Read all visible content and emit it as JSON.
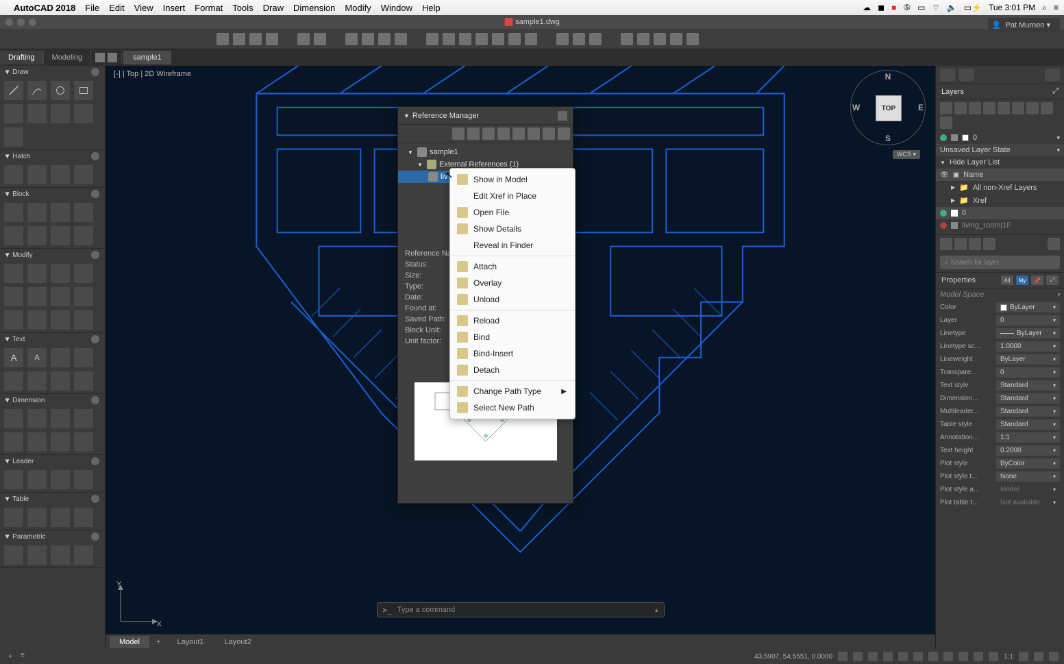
{
  "menubar": {
    "app_name": "AutoCAD 2018",
    "items": [
      "File",
      "Edit",
      "View",
      "Insert",
      "Format",
      "Tools",
      "Draw",
      "Dimension",
      "Modify",
      "Window",
      "Help"
    ],
    "clock": "Tue 3:01 PM"
  },
  "title": "sample1.dwg",
  "user": "Pat Murnen",
  "tabs": {
    "modes": [
      "Drafting",
      "Modeling"
    ],
    "active_mode": "Drafting",
    "file_tab": "sample1"
  },
  "view_label": "| Top | 2D Wireframe",
  "viewcube": {
    "top": "TOP",
    "n": "N",
    "s": "S",
    "e": "E",
    "w": "W",
    "wcs": "WCS"
  },
  "palette_sections": [
    "Draw",
    "Hatch",
    "Block",
    "Modify",
    "Text",
    "Dimension",
    "Leader",
    "Table",
    "Parametric"
  ],
  "refmgr": {
    "title": "Reference Manager",
    "tree_root": "sample1",
    "tree_ext": "External References (1)",
    "tree_sel": "liv",
    "details": [
      "Reference Name:",
      "Status:",
      "Size:",
      "Type:",
      "Date:",
      "Found at:",
      "Saved Path:",
      "Block Unit:",
      "Unit factor:"
    ]
  },
  "context_menu": {
    "items": [
      {
        "label": "Show in Model",
        "icon": "eye"
      },
      {
        "label": "Edit Xref in Place"
      },
      {
        "label": "Open File",
        "icon": "folder"
      },
      {
        "label": "Show Details",
        "icon": "info"
      },
      {
        "label": "Reveal in Finder"
      },
      {
        "sep": true
      },
      {
        "label": "Attach",
        "check": true,
        "icon": "folder"
      },
      {
        "label": "Overlay",
        "icon": "folder"
      },
      {
        "label": "Unload",
        "icon": "folder"
      },
      {
        "sep": true
      },
      {
        "label": "Reload",
        "icon": "folder"
      },
      {
        "label": "Bind",
        "icon": "folder"
      },
      {
        "label": "Bind-Insert",
        "icon": "folder"
      },
      {
        "label": "Detach",
        "icon": "folder"
      },
      {
        "sep": true
      },
      {
        "label": "Change Path Type",
        "icon": "path",
        "arrow": true
      },
      {
        "label": "Select New Path",
        "icon": "path"
      }
    ]
  },
  "layers_panel": {
    "title": "Layers",
    "current_layer": "0",
    "state": "Unsaved Layer State",
    "hide": "Hide Layer List",
    "header": "Name",
    "groups": [
      "All non-Xref Layers",
      "Xref"
    ],
    "layers": [
      "0",
      "living_room|1F"
    ],
    "search_placeholder": "Search for layer"
  },
  "properties": {
    "title": "Properties",
    "tabs": {
      "all": "All",
      "my": "My"
    },
    "scope": "Model Space",
    "rows": [
      {
        "label": "Color",
        "value": "ByLayer",
        "swatch": "#fff"
      },
      {
        "label": "Layer",
        "value": "0"
      },
      {
        "label": "Linetype",
        "value": "ByLayer",
        "line": true
      },
      {
        "label": "Linetype sc...",
        "value": "1.0000"
      },
      {
        "label": "Lineweight",
        "value": "ByLayer"
      },
      {
        "label": "Transpare...",
        "value": "0",
        "extra": true
      },
      {
        "label": "Text style",
        "value": "Standard"
      },
      {
        "label": "Dimension...",
        "value": "Standard"
      },
      {
        "label": "Multileader...",
        "value": "Standard"
      },
      {
        "label": "Table style",
        "value": "Standard"
      },
      {
        "label": "Annotation...",
        "value": "1:1"
      },
      {
        "label": "Text height",
        "value": "0.2000",
        "extra": true
      },
      {
        "label": "Plot style",
        "value": "ByColor"
      },
      {
        "label": "Plot style t...",
        "value": "None"
      },
      {
        "label": "Plot style a...",
        "value": "Model",
        "dim": true
      },
      {
        "label": "Plot table t...",
        "value": "Not available",
        "dim": true
      }
    ]
  },
  "layout_tabs": [
    "Model",
    "Layout1",
    "Layout2"
  ],
  "cmdline_placeholder": "Type a command",
  "statusbar": {
    "coords": "43.5907, 54.5551, 0.0000",
    "scale": "1:1"
  }
}
